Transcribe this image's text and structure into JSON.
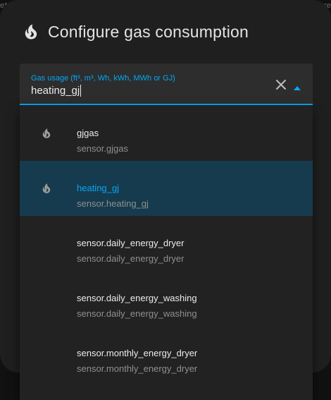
{
  "backdrop": {
    "left_text": "e*",
    "right_text": "re"
  },
  "dialog": {
    "title": "Configure gas consumption",
    "title_icon": "fire-icon"
  },
  "combo": {
    "label": "Gas usage (ft³, m³, Wh, kWh, MWh or GJ)",
    "value": "heating_gj",
    "clear_icon": "close-icon",
    "toggle_icon": "arrow-up-icon"
  },
  "colors": {
    "accent": "#03a9f4",
    "selected_bg": "#173b4e",
    "dialog_bg": "#1f1f1f",
    "field_bg": "#2d2d2d",
    "list_bg": "#222222"
  },
  "options": [
    {
      "primary": "gjgas",
      "secondary": "sensor.gjgas",
      "icon": "fire-icon",
      "selected": false
    },
    {
      "primary": "heating_gj",
      "secondary": "sensor.heating_gj",
      "icon": "fire-icon",
      "selected": true
    },
    {
      "primary": "sensor.daily_energy_dryer",
      "secondary": "sensor.daily_energy_dryer",
      "icon": "",
      "selected": false
    },
    {
      "primary": "sensor.daily_energy_washing",
      "secondary": "sensor.daily_energy_washing",
      "icon": "",
      "selected": false
    },
    {
      "primary": "sensor.monthly_energy_dryer",
      "secondary": "sensor.monthly_energy_dryer",
      "icon": "",
      "selected": false
    }
  ]
}
